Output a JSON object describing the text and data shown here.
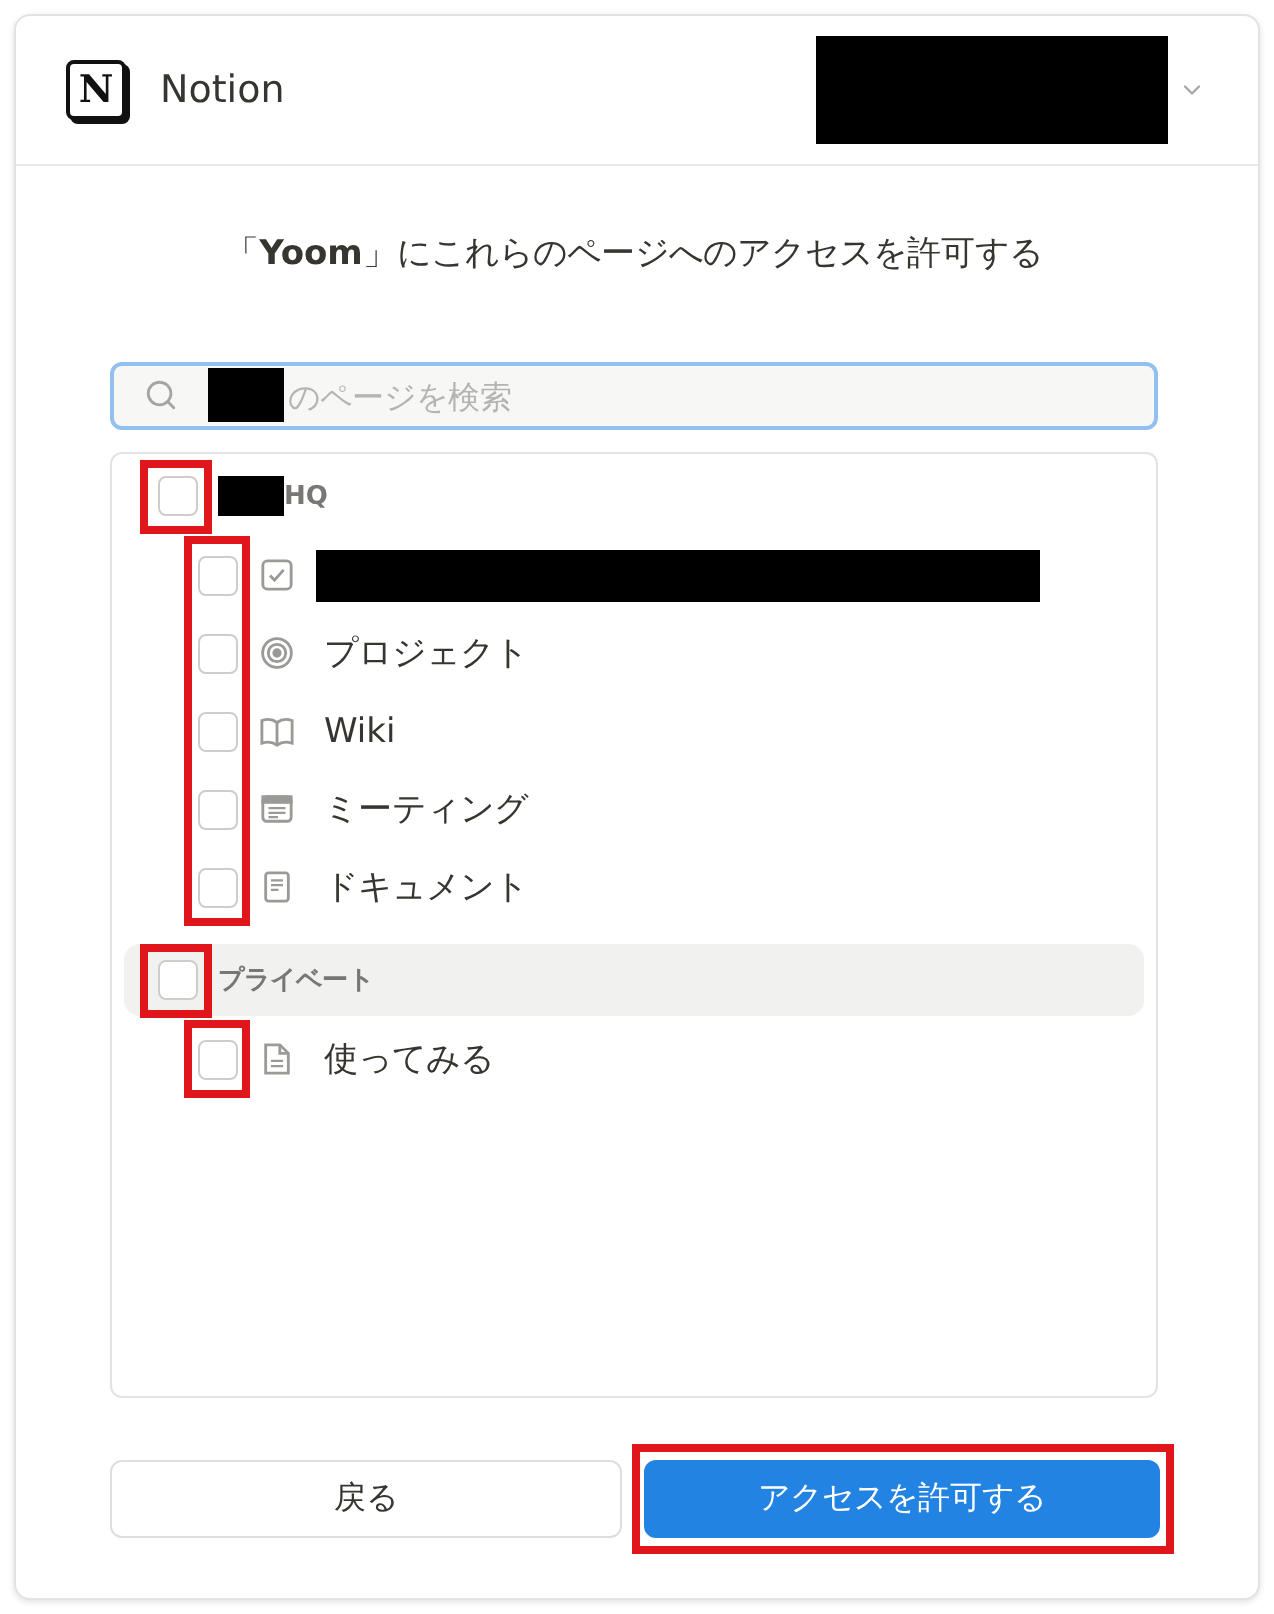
{
  "header": {
    "logo_letter": "N",
    "app_name": "Notion",
    "account_selector": {
      "redacted": true
    }
  },
  "prompt": "「**Yoom**」にこれらのページへのアクセスを許可する",
  "search": {
    "redacted_prefix": true,
    "placeholder": "のページを検索",
    "focused": true
  },
  "workspaces": [
    {
      "name": "HQ",
      "redacted_prefix": true,
      "checked": false,
      "hovered": false,
      "highlighted": true,
      "pages_highlighted": true,
      "pages": [
        {
          "kind": "checklist",
          "redacted": true,
          "checked": false
        },
        {
          "kind": "target",
          "title": "プロジェクト",
          "checked": false
        },
        {
          "kind": "book",
          "title": "Wiki",
          "checked": false
        },
        {
          "kind": "notes",
          "title": "ミーティング",
          "checked": false
        },
        {
          "kind": "page",
          "title": "ドキュメント",
          "checked": false
        }
      ]
    },
    {
      "name": "プライベート",
      "checked": false,
      "hovered": true,
      "highlighted": true,
      "pages_highlighted": true,
      "pages": [
        {
          "kind": "file",
          "title": "使ってみる",
          "checked": false
        }
      ]
    }
  ],
  "buttons": [
    {
      "label": "戻る",
      "kind": "secondary"
    },
    {
      "label": "アクセスを許可する",
      "kind": "primary",
      "highlighted": true
    }
  ]
}
